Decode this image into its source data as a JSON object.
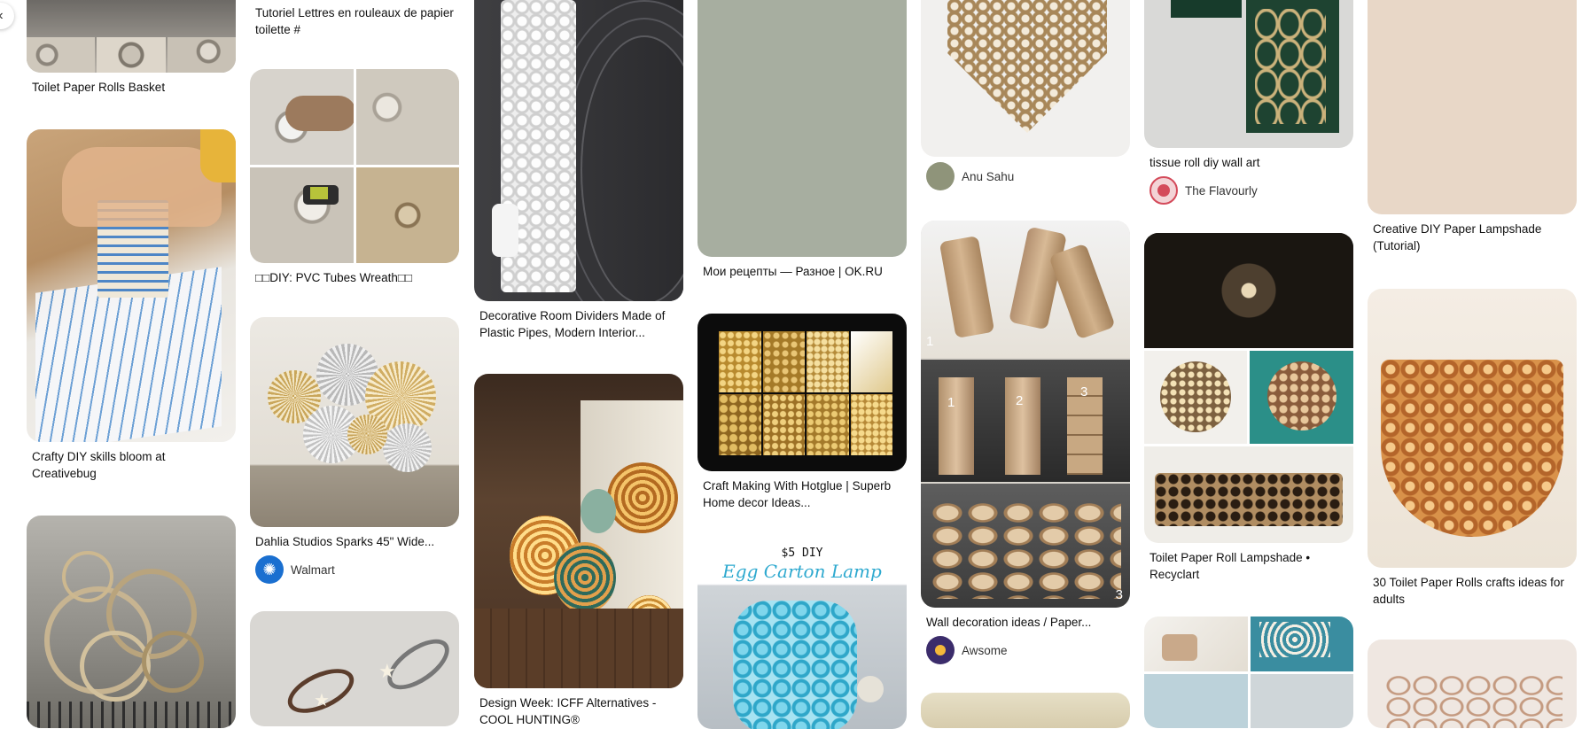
{
  "nav": {
    "back_icon": "chevron-left-icon"
  },
  "pins": [
    {
      "id": "p1",
      "title": "Toilet Paper Rolls Basket"
    },
    {
      "id": "p2",
      "title": "Crafty DIY skills bloom at Creativebug"
    },
    {
      "id": "p3",
      "title": ""
    },
    {
      "id": "p4",
      "title": "Tutoriel Lettres en rouleaux de papier toilette #"
    },
    {
      "id": "p5",
      "title": "□□DIY: PVC Tubes Wreath□□"
    },
    {
      "id": "p6",
      "title": "Dahlia Studios Sparks 45\" Wide...",
      "creator": "Walmart"
    },
    {
      "id": "p7",
      "title": ""
    },
    {
      "id": "p8",
      "title": "Decorative Room Dividers Made of Plastic Pipes, Modern Interior..."
    },
    {
      "id": "p9",
      "title": "Design Week: ICFF Alternatives - COOL HUNTING®"
    },
    {
      "id": "p10",
      "title": "Мои рецепты — Разное | OK.RU"
    },
    {
      "id": "p11",
      "title": "Craft Making With Hotglue | Superb Home decor Ideas..."
    },
    {
      "id": "p12",
      "title": "",
      "overlay_top": "$5 DIY",
      "overlay_sub": "Egg Carton Lamp"
    },
    {
      "id": "p13",
      "title": "",
      "creator": "Anu Sahu"
    },
    {
      "id": "p14",
      "title": "Wall decoration ideas / Paper...",
      "creator": "Awsome",
      "overlay_numbers": [
        "1",
        "1",
        "2",
        "3",
        "3"
      ]
    },
    {
      "id": "p15",
      "title": ""
    },
    {
      "id": "p16",
      "title": "tissue roll diy wall art",
      "creator": "The Flavourly"
    },
    {
      "id": "p17",
      "title": "Toilet Paper Roll Lampshade • Recyclart"
    },
    {
      "id": "p18",
      "title": ""
    },
    {
      "id": "p19",
      "title": "Creative DIY Paper Lampshade (Tutorial)"
    },
    {
      "id": "p20",
      "title": "30 Toilet Paper Rolls crafts ideas for adults"
    },
    {
      "id": "p21",
      "title": ""
    }
  ]
}
